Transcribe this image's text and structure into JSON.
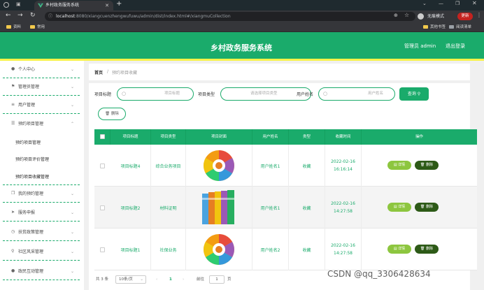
{
  "browser": {
    "tab_title": "乡村政务服务系统",
    "url_host": "localhost",
    "url_rest": ":8080/xiangcuenzhengwufuwu/admin/dist/index.html#/xiangmuCollection",
    "incognito_label": "无痕模式",
    "update_label": "更新",
    "bookmarks": [
      "资料",
      "常用"
    ],
    "bookmarks_right": [
      "其他书签",
      "阅读清单"
    ]
  },
  "header": {
    "title": "乡村政务服务系统",
    "admin_label": "管理员 admin",
    "logout_label": "退出登录"
  },
  "sidebar": {
    "items": [
      {
        "label": "个人中心",
        "icon": "user-icon"
      },
      {
        "label": "管理员管理",
        "icon": "flag-icon"
      },
      {
        "label": "用户管理",
        "icon": "sliders-icon"
      },
      {
        "label": "预约项目管理",
        "icon": "list-icon"
      },
      {
        "label": "我的预约管理",
        "icon": "copy-icon"
      },
      {
        "label": "服务申报",
        "icon": "send-icon"
      },
      {
        "label": "扶贫政策管理",
        "icon": "clock-icon"
      },
      {
        "label": "社区风采管理",
        "icon": "link-icon"
      },
      {
        "label": "政民互动管理",
        "icon": "user-icon"
      }
    ],
    "sub_items": [
      "预约项目管理",
      "预约项目评价管理",
      "预约项目收藏管理"
    ]
  },
  "breadcrumb": {
    "home": "首页",
    "sep": "/",
    "current": "预约项目收藏"
  },
  "search": {
    "title_label": "项目标题",
    "title_placeholder": "项目标题",
    "type_label": "项目类型",
    "type_placeholder": "请选择项目类型",
    "user_label": "用户姓名",
    "user_placeholder": "用户姓名",
    "query_label": "查询",
    "delete_label": "删除"
  },
  "table": {
    "headers": [
      "项目标题",
      "项目类型",
      "项目封面",
      "用户姓名",
      "类型",
      "收藏时间",
      "操作"
    ],
    "rows": [
      {
        "title": "项目标题4",
        "type": "综合业务项目",
        "user": "用户姓名1",
        "kind": "收藏",
        "date": "2022-02-16",
        "time": "16:16:14",
        "cover": "wheel"
      },
      {
        "title": "项目标题2",
        "type": "材料证明",
        "user": "用户姓名1",
        "kind": "收藏",
        "date": "2022-02-16",
        "time": "14:27:58",
        "cover": "books"
      },
      {
        "title": "项目标题1",
        "type": "社保业务",
        "user": "用户姓名2",
        "kind": "收藏",
        "date": "2022-02-16",
        "time": "14:27:58",
        "cover": "wheel"
      }
    ],
    "detail_label": "详情",
    "delete_label": "删除"
  },
  "pagination": {
    "total": "共 3 条",
    "page_size": "10条/页",
    "current": "1",
    "goto_label": "前往",
    "goto_value": "1",
    "page_unit": "页"
  },
  "watermark": "CSDN @qq_3306428634",
  "colors": {
    "accent": "#1aab6b",
    "yellow": "#f7f24a",
    "detail": "#8dc63f",
    "delete": "#2d5a17"
  }
}
